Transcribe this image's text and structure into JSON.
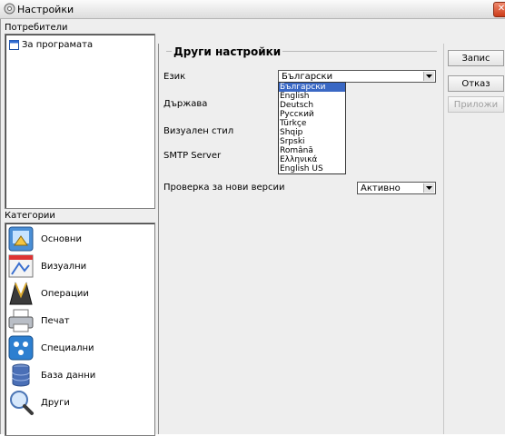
{
  "window": {
    "title": "Настройки",
    "close_symbol": "✕",
    "icon": "gear-icon"
  },
  "users": {
    "label": "Потребители",
    "items": [
      {
        "label": "За програмата",
        "icon": "window-icon"
      }
    ]
  },
  "categories": {
    "label": "Категории",
    "items": [
      {
        "label": "Основни",
        "icon": "basic-settings-icon"
      },
      {
        "label": "Визуални",
        "icon": "visual-settings-icon"
      },
      {
        "label": "Операции",
        "icon": "operations-icon"
      },
      {
        "label": "Печат",
        "icon": "printer-icon"
      },
      {
        "label": "Специални",
        "icon": "special-icon"
      },
      {
        "label": "База данни",
        "icon": "database-icon"
      },
      {
        "label": "Други",
        "icon": "magnifier-icon"
      }
    ]
  },
  "other_settings": {
    "title": "Други настройки",
    "fields": {
      "language": "Език",
      "country": "Държава",
      "visual_style": "Визуален стил",
      "smtp": "SMTP Server",
      "update_check": "Проверка за нови версии"
    },
    "language_value": "Български",
    "update_check_value": "Активно",
    "language_options": [
      "Български",
      "English",
      "Deutsch",
      "Русский",
      "Türkçe",
      "Shqip",
      "Srpski",
      "Română",
      "Ελληνικά",
      "English US"
    ],
    "selected_option": "Български"
  },
  "buttons": {
    "save": "Запис",
    "cancel": "Отказ",
    "apply": "Приложи"
  },
  "colors": {
    "selection": "#3a68c4",
    "panel": "#eeeeee"
  }
}
